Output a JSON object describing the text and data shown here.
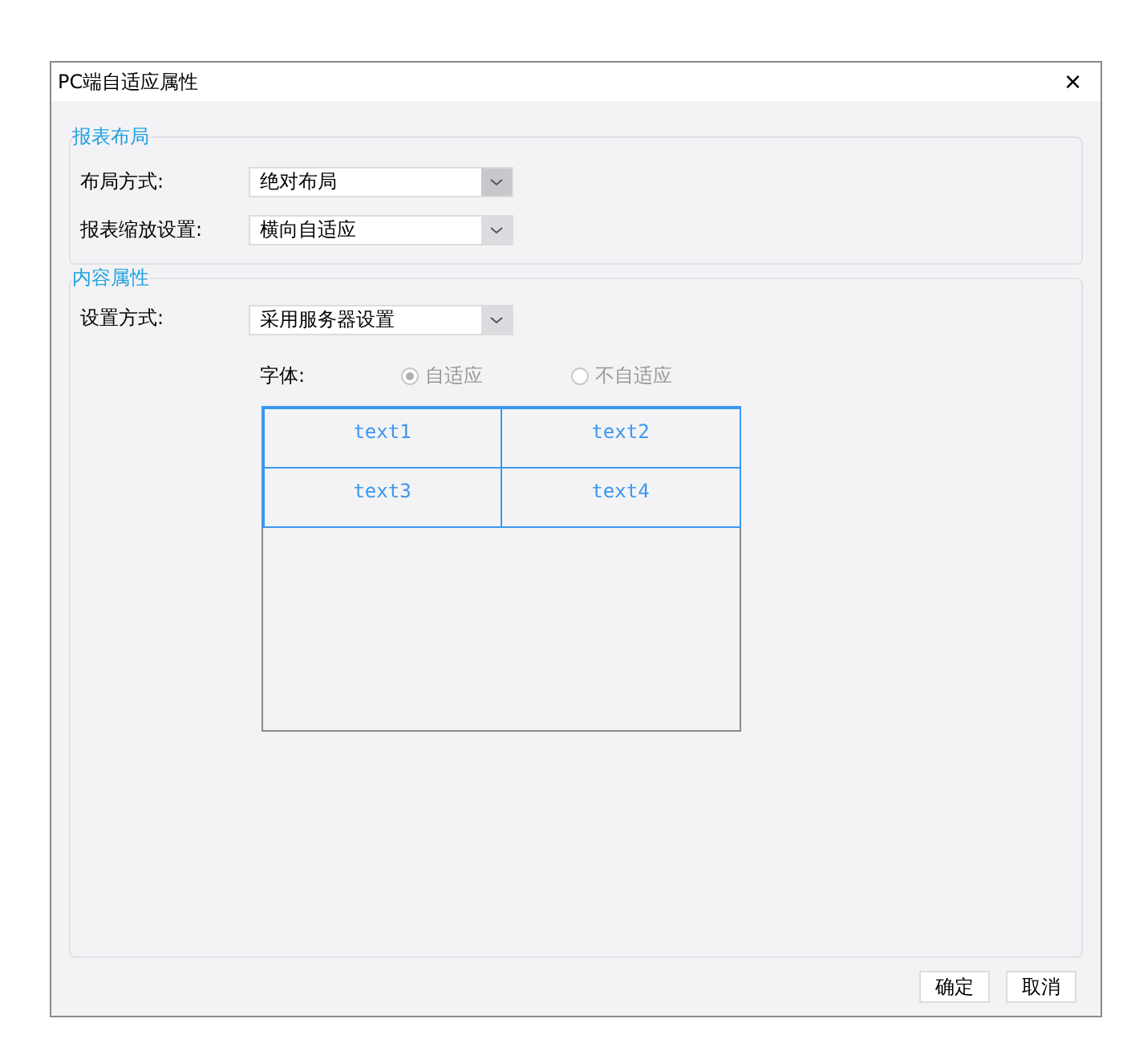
{
  "window": {
    "title": "PC端自适应属性",
    "close": "×"
  },
  "layout_section": {
    "legend": "报表布局",
    "fields": [
      {
        "label": "布局方式:",
        "value": "绝对布局"
      },
      {
        "label": "报表缩放设置:",
        "value": "横向自适应"
      }
    ]
  },
  "content_section": {
    "legend": "内容属性",
    "field": {
      "label": "设置方式:",
      "value": "采用服务器设置"
    },
    "font": {
      "label": "字体:",
      "options": [
        {
          "label": "自适应",
          "selected": true,
          "disabled": true
        },
        {
          "label": "不自适应",
          "selected": false,
          "disabled": true
        }
      ]
    },
    "preview_cells": [
      "text1",
      "text2",
      "text3",
      "text4"
    ]
  },
  "buttons": [
    "确定",
    "取消"
  ]
}
